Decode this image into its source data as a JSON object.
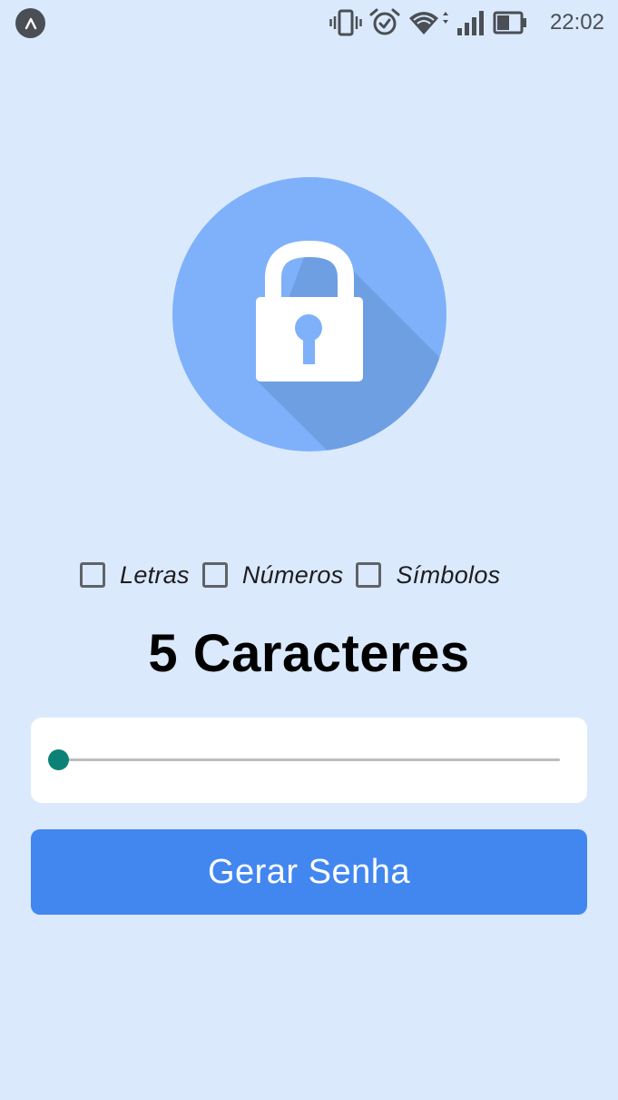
{
  "status_bar": {
    "time": "22:02",
    "icons": [
      "app-badge-icon",
      "vibrate-icon",
      "alarm-icon",
      "wifi-icon",
      "signal-icon",
      "battery-icon"
    ]
  },
  "hero": {
    "icon": "lock-icon",
    "circle_color": "#7fb1fb",
    "shadow_color": "#6e9fe2"
  },
  "options": [
    {
      "label": "Letras",
      "checked": false
    },
    {
      "label": "Números",
      "checked": false
    },
    {
      "label": "Símbolos",
      "checked": false
    }
  ],
  "length": {
    "title": "5 Caracteres",
    "value_fraction": 0
  },
  "generate_button": {
    "label": "Gerar Senha"
  },
  "colors": {
    "background": "#dbe9fd",
    "accent": "#4287f0",
    "slider_accent": "#0b8275"
  }
}
